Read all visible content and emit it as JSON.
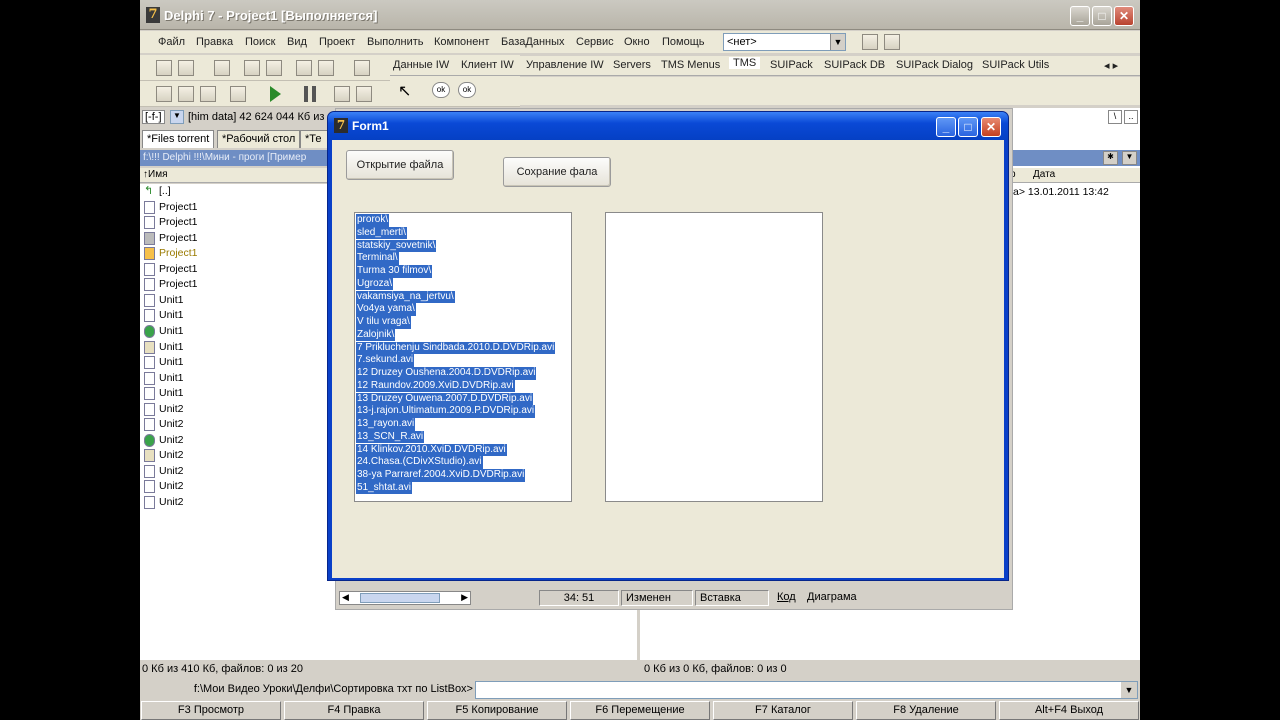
{
  "ide": {
    "title": "Delphi 7 - Project1 [Выполняется]",
    "menu": [
      "Файл",
      "Правка",
      "Поиск",
      "Вид",
      "Проект",
      "Выполнить",
      "Компонент",
      "БазаДанных",
      "Сервис",
      "Окно",
      "Помощь"
    ],
    "combo_value": "<нет>",
    "palette_tabs": [
      "Данные IW",
      "Клиент IW",
      "Управление IW",
      "Servers",
      "TMS Menus",
      "TMS",
      "SUIPack",
      "SUIPack DB",
      "SUIPack Dialog",
      "SUIPack Utils"
    ],
    "active_palette_tab": "TMS",
    "comp_ok1": "ok",
    "comp_ok2": "ok"
  },
  "commander": {
    "drive_label": "[-f-]",
    "drive_info": "[him data]  42 624 044 Кб из",
    "tabs": [
      "*Files torrent",
      "*Рабочий стол",
      "*Те"
    ],
    "path": "f:\\!!! Delphi !!!\\Мини - проги [Пример",
    "col_name": "↑Имя",
    "col_date_prefix": "р",
    "col_date": "Дата",
    "files": [
      {
        "name": "[..]",
        "icon": "up-arrow-icon"
      },
      {
        "name": "Project1",
        "icon": "file-icon"
      },
      {
        "name": "Project1",
        "icon": "file-icon"
      },
      {
        "name": "Project1",
        "icon": "config-file-icon"
      },
      {
        "name": "Project1",
        "icon": "delphi-project-icon"
      },
      {
        "name": "Project1",
        "icon": "file-icon"
      },
      {
        "name": "Project1",
        "icon": "file-icon"
      },
      {
        "name": "Unit1",
        "icon": "file-icon"
      },
      {
        "name": "Unit1",
        "icon": "file-icon"
      },
      {
        "name": "Unit1",
        "icon": "unit-icon"
      },
      {
        "name": "Unit1",
        "icon": "form-icon"
      },
      {
        "name": "Unit1",
        "icon": "file-icon"
      },
      {
        "name": "Unit1",
        "icon": "file-icon"
      },
      {
        "name": "Unit1",
        "icon": "file-icon"
      },
      {
        "name": "Unit2",
        "icon": "file-icon"
      },
      {
        "name": "Unit2",
        "icon": "file-icon"
      },
      {
        "name": "Unit2",
        "icon": "unit-icon"
      },
      {
        "name": "Unit2",
        "icon": "form-icon"
      },
      {
        "name": "Unit2",
        "icon": "file-icon"
      },
      {
        "name": "Unit2",
        "icon": "file-icon"
      },
      {
        "name": "Unit2",
        "icon": "file-icon"
      }
    ],
    "right_first_row": "а> 13.01.2011 13:42",
    "status_left": "0 Кб из 410 Кб, файлов: 0 из 20",
    "status_right": "0 Кб из 0 Кб, файлов: 0 из 0",
    "cmd_label": "f:\\Мои Видео Уроки\\Делфи\\Сортировка тхт по ListBox>",
    "fkeys": [
      "F3 Просмотр",
      "F4 Правка",
      "F5 Копирование",
      "F6 Перемещение",
      "F7 Каталог",
      "F8 Удаление",
      "Alt+F4 Выход"
    ]
  },
  "editor_status": {
    "position": "34:  51",
    "modified": "Изменен",
    "mode": "Вставка",
    "tab_code": "Код",
    "tab_diagram": "Диаграма"
  },
  "form1": {
    "title": "Form1",
    "open_button": "Открытие файла",
    "save_button": "Сохрание фала",
    "listbox_items": [
      "prorok\\",
      "sled_merti\\",
      "statskiy_sovetnik\\",
      "Terminal\\",
      "Turma 30 filmov\\",
      "Ugroza\\",
      "vakamsiya_na_jertvu\\",
      "Vo4ya yama\\",
      "V tilu vraga\\",
      "Zalojnik\\",
      "7 Prikluchenju Sindbada.2010.D.DVDRip.avi",
      "7.sekund.avi",
      "12 Druzey Oushena.2004.D.DVDRip.avi",
      "12 Raundov.2009.XviD.DVDRip.avi",
      "13 Druzey Ouwena.2007.D.DVDRip.avi",
      "13-j.rajon.Ultimatum.2009.P.DVDRip.avi",
      "13_rayon.avi",
      "13_SCN_R.avi",
      "14 Klinkov.2010.XviD.DVDRip.avi",
      "24.Chasa.(CDivXStudio).avi",
      "38-ya Parraref.2004.XviD.DVDRip.avi",
      "51_shtat.avi"
    ]
  }
}
